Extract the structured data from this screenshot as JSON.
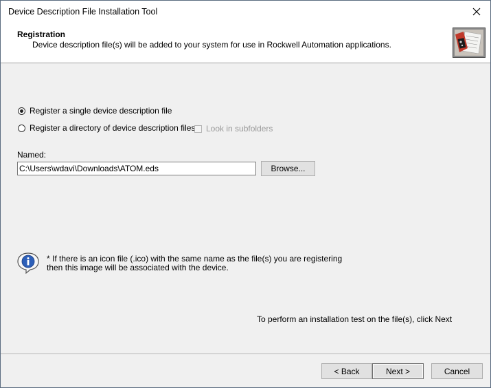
{
  "window": {
    "title": "Device Description File Installation Tool",
    "close_glyph": "✕"
  },
  "header": {
    "title": "Registration",
    "description": "Device description file(s) will be added to your system for use in Rockwell Automation applications.",
    "image_icon": "installer-graphic-icon"
  },
  "options": {
    "single_label": "Register a single device description file",
    "single_checked": true,
    "directory_label": "Register a directory of device description files",
    "directory_checked": false,
    "subfolders_label": "Look in subfolders",
    "subfolders_enabled": false
  },
  "file": {
    "named_label": "Named:",
    "path_value": "C:\\Users\\wdavi\\Downloads\\ATOM.eds",
    "browse_label": "Browse..."
  },
  "info": {
    "icon": "info-icon",
    "line1": "* If there is an icon file (.ico) with the same name as the file(s) you are registering",
    "line2": "then this image will be associated with the device."
  },
  "test_hint": "To perform an installation test on the file(s), click  Next",
  "footer": {
    "back_label": "< Back",
    "next_label": "Next >",
    "cancel_label": "Cancel"
  }
}
